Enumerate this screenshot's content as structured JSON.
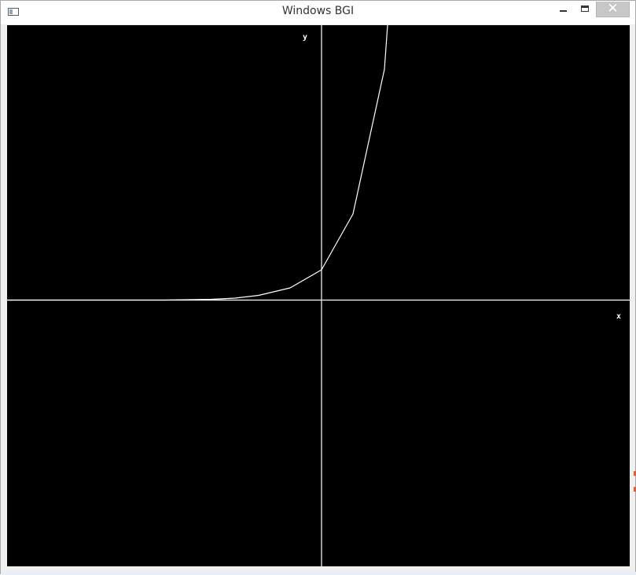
{
  "window": {
    "title": "Windows BGI",
    "close_glyph": "✕"
  },
  "colors": {
    "canvas_background": "#000000",
    "axis": "#ffffff",
    "curve": "#ffffff",
    "title_bar": "#ffffff",
    "close_button": "#c7c7c7"
  },
  "icons": {
    "app": "window-icon",
    "minimize": "minimize-icon",
    "maximize": "maximize-icon",
    "close": "close-icon"
  },
  "plot": {
    "x_label": "x",
    "y_label": "y"
  }
}
